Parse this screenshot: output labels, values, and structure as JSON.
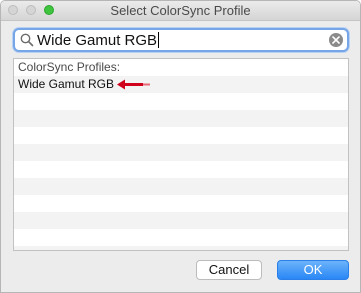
{
  "window": {
    "title": "Select ColorSync Profile"
  },
  "search": {
    "query": "Wide Gamut RGB"
  },
  "list": {
    "header": "ColorSync Profiles:",
    "items": [
      "Wide Gamut RGB"
    ]
  },
  "buttons": {
    "cancel": "Cancel",
    "ok": "OK"
  },
  "colors": {
    "accent": "#2987f6",
    "annotation_arrow": "#d0021b"
  }
}
